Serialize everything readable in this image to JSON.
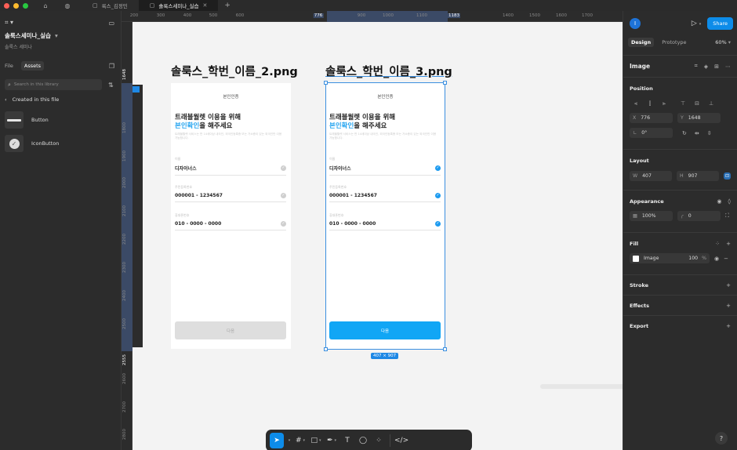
{
  "titlebar": {
    "tabs": [
      {
        "label": "룩스_김정민",
        "active": false
      },
      {
        "label": "솔룩스세미나_실습",
        "active": true
      }
    ]
  },
  "left_panel": {
    "project_name": "솔룩스세미나_실습",
    "team_name": "솔룩스 세미나",
    "tabs": [
      "File",
      "Assets"
    ],
    "active_tab": "Assets",
    "search_placeholder": "Search in this library",
    "section_label": "Created in this file",
    "assets": [
      {
        "name": "Button",
        "thumb": "bar"
      },
      {
        "name": "IconButton",
        "thumb": "check-circle"
      }
    ]
  },
  "rulers": {
    "top": [
      "200",
      "300",
      "400",
      "500",
      "600",
      "776",
      "900",
      "1000",
      "1100",
      "1183",
      "1400",
      "1500",
      "1600",
      "1700"
    ],
    "left": [
      "1648",
      "1800",
      "1900",
      "2000",
      "2100",
      "2200",
      "2300",
      "2400",
      "2500",
      "2555",
      "2600",
      "2700",
      "2800",
      "2900"
    ]
  },
  "canvas": {
    "frames": [
      {
        "label": "솔룩스_학번_이름_2.png",
        "header": "본인인증",
        "headline_line1": "트래블월렛 이용을 위해",
        "headline_blue": "본인확인",
        "headline_rest": "을 해주세요",
        "description": "트래블월렛 서비스는 만 14세이상 내국인, 외국인등록증 또는 거소증이 있는 외국인만 이용 가능합니다.",
        "fields": [
          {
            "label": "이름",
            "value": "디자이너스"
          },
          {
            "label": "주민등록번호",
            "value": "000001 - 1234567"
          },
          {
            "label": "휴대폰번호",
            "value": "010 - 0000 - 0000"
          }
        ],
        "button": "다음",
        "checked": false
      },
      {
        "label": "솔룩스_학번_이름_3.png",
        "header": "본인인증",
        "headline_line1": "트래블월렛 이용을 위해",
        "headline_blue": "본인확인",
        "headline_rest": "을 해주세요",
        "description": "트래블월렛 서비스는 만 14세이상 내국인, 외국인등록증 또는 거소증이 있는 외국인만 이용 가능합니다.",
        "fields": [
          {
            "label": "이름",
            "value": "디자이너스"
          },
          {
            "label": "주민등록번호",
            "value": "000001 - 1234567"
          },
          {
            "label": "휴대폰번호",
            "value": "010 - 0000 - 0000"
          }
        ],
        "button": "다음",
        "checked": true
      }
    ],
    "selection_dimensions": "407 × 907"
  },
  "right_panel": {
    "avatar_initial": "I",
    "share_label": "Share",
    "tabs": [
      "Design",
      "Prototype"
    ],
    "active_tab": "Design",
    "zoom": "60%",
    "node_type": "Image",
    "position": {
      "title": "Position",
      "x_label": "X",
      "x": "776",
      "y_label": "Y",
      "y": "1648",
      "rotation": "0°"
    },
    "layout": {
      "title": "Layout",
      "w_label": "W",
      "w": "407",
      "h_label": "H",
      "h": "907"
    },
    "appearance": {
      "title": "Appearance",
      "opacity": "100%",
      "radius": "0"
    },
    "fill": {
      "title": "Fill",
      "type": "Image",
      "opacity": "100",
      "unit": "%"
    },
    "stroke": "Stroke",
    "effects": "Effects",
    "export": "Export"
  },
  "colors": {
    "accent": "#0d8ce9",
    "selection": "#3b8fe0",
    "cta": "#11a6f5",
    "highlight_text": "#26a5f0"
  }
}
